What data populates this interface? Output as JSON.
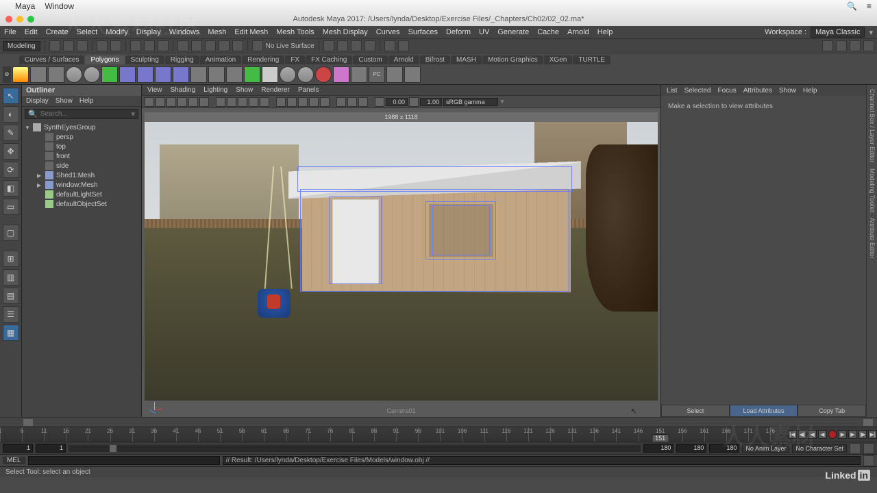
{
  "mac_menu": {
    "app": "Maya",
    "window": "Window"
  },
  "titlebar": {
    "title": "Autodesk Maya 2017: /Users/lynda/Desktop/Exercise Files/_Chapters/Ch02/02_02.ma*"
  },
  "main_menu": {
    "items": [
      "File",
      "Edit",
      "Create",
      "Select",
      "Modify",
      "Display",
      "Windows",
      "Mesh",
      "Edit Mesh",
      "Mesh Tools",
      "Mesh Display",
      "Curves",
      "Surfaces",
      "Deform",
      "UV",
      "Generate",
      "Cache",
      "Arnold",
      "Help"
    ],
    "workspace_label": "Workspace :",
    "workspace_value": "Maya Classic"
  },
  "statusline": {
    "mode": "Modeling",
    "live_surface": "No Live Surface"
  },
  "shelf": {
    "tabs": [
      "Curves / Surfaces",
      "Polygons",
      "Sculpting",
      "Rigging",
      "Animation",
      "Rendering",
      "FX",
      "FX Caching",
      "Custom",
      "Arnold",
      "Bifrost",
      "MASH",
      "Motion Graphics",
      "XGen",
      "TURTLE"
    ],
    "active_tab": 1
  },
  "outliner": {
    "title": "Outliner",
    "menu": [
      "Display",
      "Show",
      "Help"
    ],
    "search_placeholder": "Search...",
    "items": [
      {
        "depth": 0,
        "type": "grp",
        "name": "SynthEyesGroup",
        "tri": "open"
      },
      {
        "depth": 1,
        "type": "cam",
        "name": "persp"
      },
      {
        "depth": 1,
        "type": "cam",
        "name": "top"
      },
      {
        "depth": 1,
        "type": "cam",
        "name": "front"
      },
      {
        "depth": 1,
        "type": "cam",
        "name": "side"
      },
      {
        "depth": 1,
        "type": "mesh",
        "name": "Shed1:Mesh",
        "tri": "closed"
      },
      {
        "depth": 1,
        "type": "mesh",
        "name": "window:Mesh",
        "tri": "closed"
      },
      {
        "depth": 1,
        "type": "set",
        "name": "defaultLightSet"
      },
      {
        "depth": 1,
        "type": "set",
        "name": "defaultObjectSet"
      }
    ]
  },
  "viewport": {
    "menu": [
      "View",
      "Shading",
      "Lighting",
      "Show",
      "Renderer",
      "Panels"
    ],
    "gate_label": "1988 x 1118",
    "exposure": "0.00",
    "gamma": "1.00",
    "color_mgmt": "sRGB gamma",
    "camera_label": "Camera01"
  },
  "attribute_editor": {
    "menu": [
      "List",
      "Selected",
      "Focus",
      "Attributes",
      "Show",
      "Help"
    ],
    "placeholder": "Make a selection to view attributes",
    "buttons": {
      "select": "Select",
      "load": "Load Attributes",
      "copy": "Copy Tab"
    }
  },
  "right_tabs": [
    "Channel Box / Layer Editor",
    "Modeling Toolkit",
    "Attribute Editor"
  ],
  "timeline": {
    "start": 1,
    "end": 180,
    "major": 5,
    "current": 151,
    "range_start_val": "1",
    "range_min": "1",
    "range_end_val": "180",
    "range_max": "180",
    "range_out": "180",
    "anim_layer": "No Anim Layer",
    "char_set": "No Character Set"
  },
  "cmdline": {
    "lang": "MEL",
    "output": "// Result: /Users/lynda/Desktop/Exercise Files/Models/window.obj //"
  },
  "helpline": {
    "text": "Select Tool: select an object"
  },
  "branding": {
    "text_a": "Linked",
    "text_b": "in"
  }
}
